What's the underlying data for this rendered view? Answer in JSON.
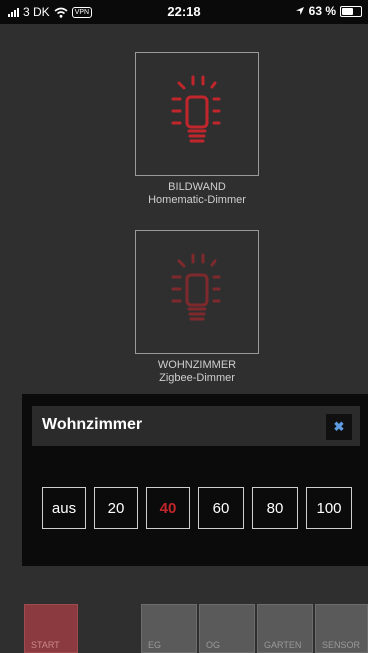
{
  "status_bar": {
    "carrier": "3 DK",
    "vpn": "VPN",
    "time": "22:18",
    "battery": "63 %",
    "battery_level": 0.63
  },
  "devices": [
    {
      "name": "BILDWAND",
      "type": "Homematic-Dimmer"
    },
    {
      "name": "WOHNZIMMER",
      "type": "Zigbee-Dimmer"
    }
  ],
  "popup": {
    "title": "Wohnzimmer",
    "close_label": "✖",
    "levels": [
      "aus",
      "20",
      "40",
      "60",
      "80",
      "100"
    ],
    "active_level": "40"
  },
  "nav": {
    "start": "START",
    "eg": "EG",
    "og": "OG",
    "garten": "GARTEN",
    "sensor": "SENSOR"
  },
  "colors": {
    "accent_red": "#c0262b",
    "close_blue": "#5c9be0"
  }
}
